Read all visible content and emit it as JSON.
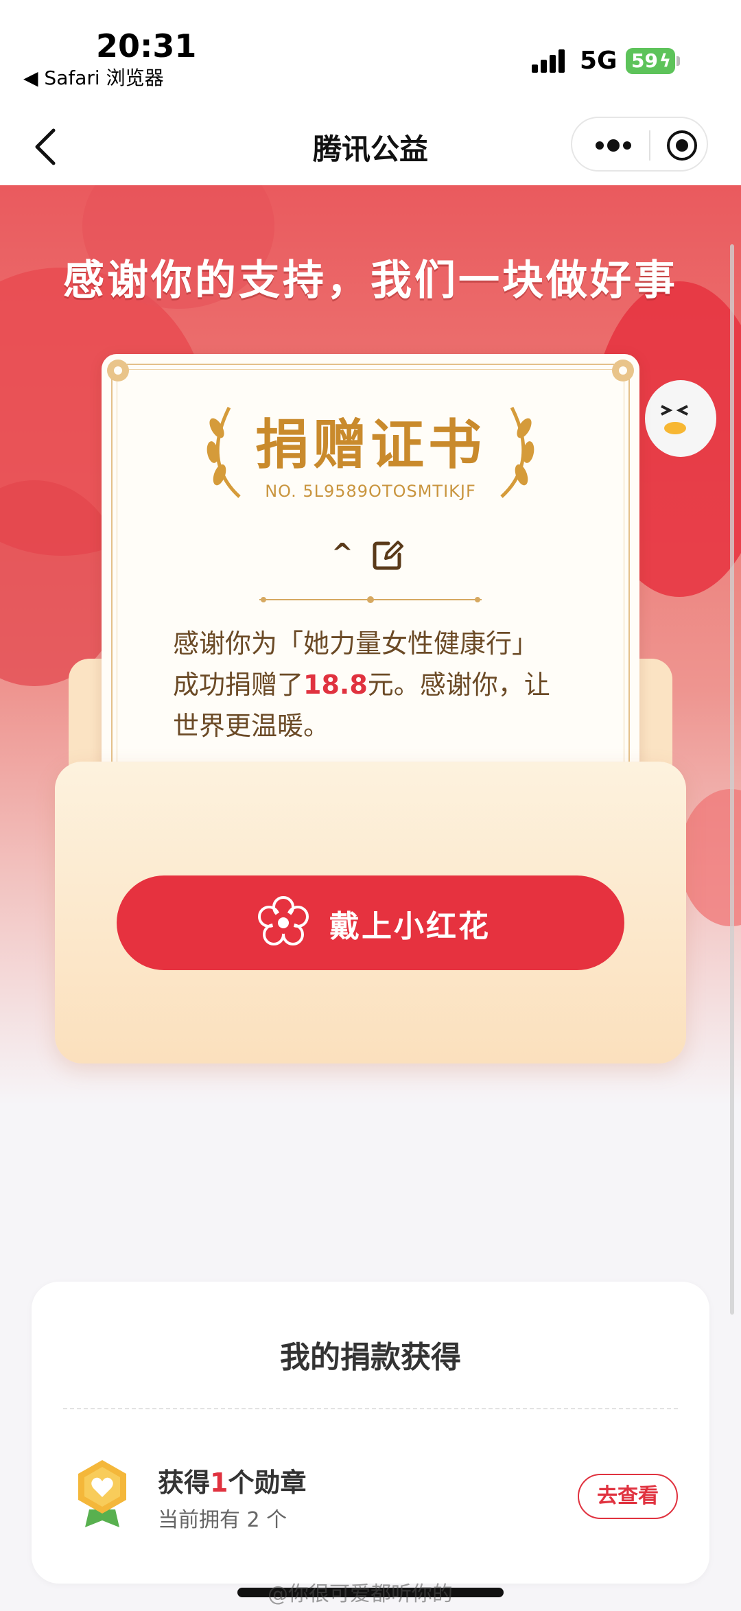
{
  "status_bar": {
    "time": "20:31",
    "back_app": "◀ Safari 浏览器",
    "network": "5G",
    "battery": "59"
  },
  "nav": {
    "title": "腾讯公益"
  },
  "hero": {
    "title": "感谢你的支持，我们一块做好事"
  },
  "certificate": {
    "title": "捐赠证书",
    "number": "NO. 5L9589OTOSMTIKJF",
    "caret": "^",
    "line1": "感谢你为「她力量女性健康行」",
    "line2_pre": "成功捐赠了",
    "amount": "18.8",
    "line2_post": "元。感谢你，让",
    "line3": "世界更温暖。"
  },
  "flower_button": {
    "label": "戴上小红花"
  },
  "donation_card": {
    "title": "我的捐款获得",
    "medal_prefix": "获得",
    "medal_count": "1",
    "medal_suffix": "个勋章",
    "medal_sub": "当前拥有 2 个",
    "view_label": "去查看"
  },
  "watermark": "@你很可爱都听你的",
  "colors": {
    "accent": "#e6323f",
    "gold": "#c98a2c",
    "hero": "#ea5a5e"
  }
}
